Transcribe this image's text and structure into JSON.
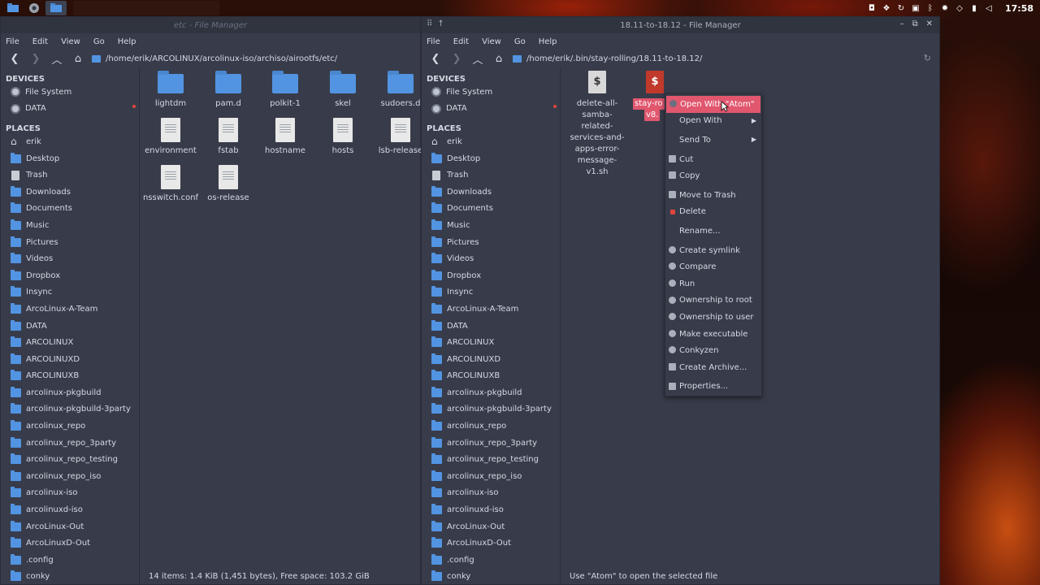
{
  "panel": {
    "clock": "17:58"
  },
  "left_window": {
    "title": "etc - File Manager",
    "menu": [
      "File",
      "Edit",
      "View",
      "Go",
      "Help"
    ],
    "path": "/home/erik/ARCOLINUX/arcolinux-iso/archiso/airootfs/etc/",
    "devices_header": "DEVICES",
    "places_header": "PLACES",
    "devices": [
      "File System",
      "DATA"
    ],
    "places": [
      "erik",
      "Desktop",
      "Trash",
      "Downloads",
      "Documents",
      "Music",
      "Pictures",
      "Videos",
      "Dropbox",
      "Insync",
      "ArcoLinux-A-Team",
      "DATA",
      "ARCOLINUX",
      "ARCOLINUXD",
      "ARCOLINUXB",
      "arcolinux-pkgbuild",
      "arcolinux-pkgbuild-3party",
      "arcolinux_repo",
      "arcolinux_repo_3party",
      "arcolinux_repo_testing",
      "arcolinux_repo_iso",
      "arcolinux-iso",
      "arcolinuxd-iso",
      "ArcoLinux-Out",
      "ArcoLinuxD-Out",
      ".config",
      "conky"
    ],
    "files": {
      "f0": "lightdm",
      "f1": "pam.d",
      "f2": "polkit-1",
      "f3": "skel",
      "f4": "sudoers.d",
      "f5": "environment",
      "f6": "fstab",
      "f7": "hostname",
      "f8": "hosts",
      "f9": "lsb-release",
      "f10": "nsswitch.conf",
      "f11": "os-release"
    },
    "status": "14 items: 1.4 KiB (1,451 bytes), Free space: 103.2 GiB"
  },
  "right_window": {
    "title": "18.11-to-18.12 - File Manager",
    "menu": [
      "File",
      "Edit",
      "View",
      "Go",
      "Help"
    ],
    "path": "/home/erik/.bin/stay-rolling/18.11-to-18.12/",
    "devices_header": "DEVICES",
    "places_header": "PLACES",
    "devices": [
      "File System",
      "DATA"
    ],
    "places": [
      "erik",
      "Desktop",
      "Trash",
      "Downloads",
      "Documents",
      "Music",
      "Pictures",
      "Videos",
      "Dropbox",
      "Insync",
      "ArcoLinux-A-Team",
      "DATA",
      "ARCOLINUX",
      "ARCOLINUXD",
      "ARCOLINUXB",
      "arcolinux-pkgbuild",
      "arcolinux-pkgbuild-3party",
      "arcolinux_repo",
      "arcolinux_repo_3party",
      "arcolinux_repo_testing",
      "arcolinux_repo_iso",
      "arcolinux-iso",
      "arcolinuxd-iso",
      "ArcoLinux-Out",
      "ArcoLinuxD-Out",
      ".config",
      "conky"
    ],
    "file1_lines": [
      "delete-all-",
      "samba-related-",
      "services-and-",
      "apps-error-",
      "message-v1.sh"
    ],
    "file2_lines": [
      "stay-ro",
      "v8."
    ],
    "status": "Use \"Atom\" to open the selected file"
  },
  "context_menu": {
    "items": [
      "Open With \"Atom\"",
      "Open With",
      "Send To",
      "Cut",
      "Copy",
      "Move to Trash",
      "Delete",
      "Rename...",
      "Create symlink",
      "Compare",
      "Run",
      "Ownership to root",
      "Ownership to user",
      "Make executable",
      "Conkyzen",
      "Create Archive...",
      "Properties..."
    ]
  }
}
